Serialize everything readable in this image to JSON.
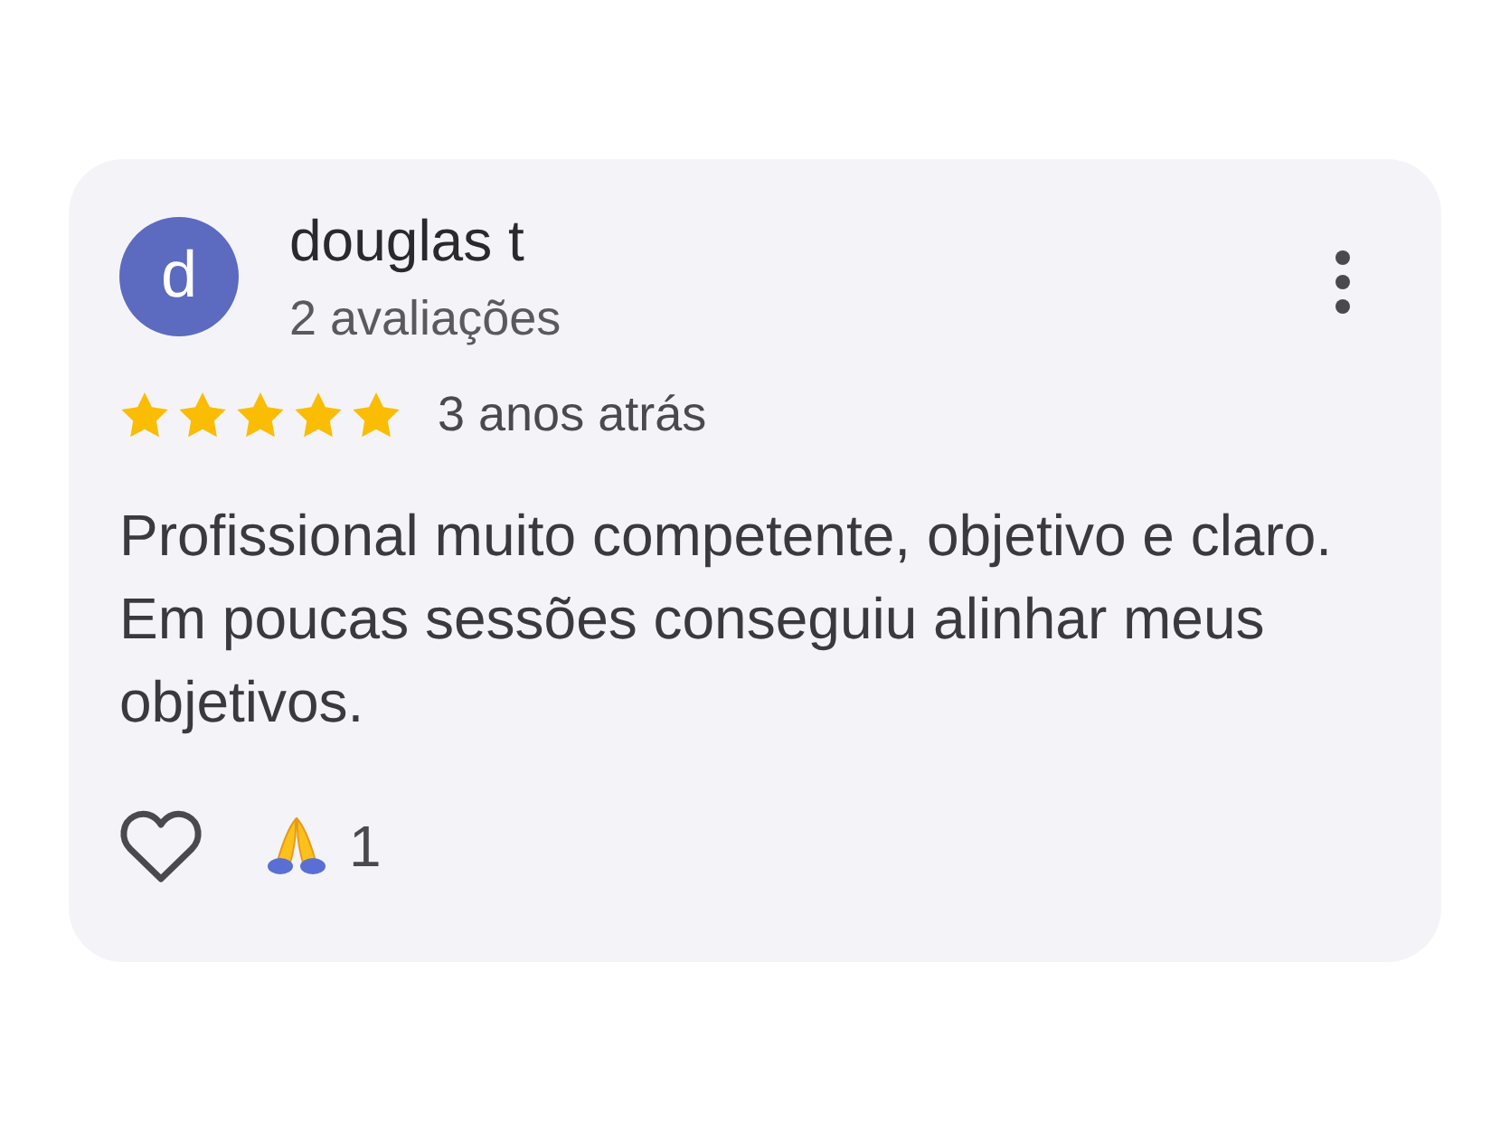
{
  "review": {
    "author": {
      "initial": "d",
      "name": "douglas t"
    },
    "review_count": "2 avaliações",
    "stars": 5,
    "time": "3 anos atrás",
    "text": "Profissional muito competente, objetivo e claro. Em poucas sessões conseguiu alinhar meus objetivos.",
    "liked": false,
    "reactions": [
      {
        "count": "1"
      }
    ]
  }
}
